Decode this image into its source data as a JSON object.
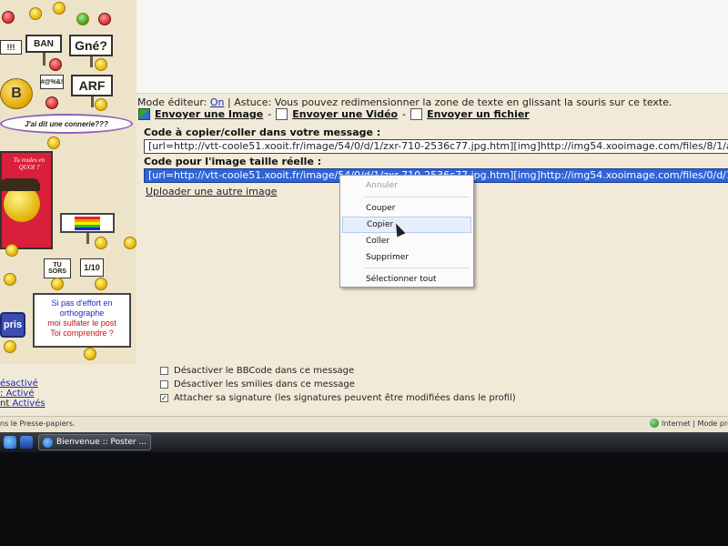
{
  "editor": {
    "mode_label": "Mode éditeur:",
    "mode_value": "On",
    "tip": " | Astuce: Vous pouvez redimensionner la zone de texte en glissant la souris sur ce texte.",
    "send_image": "Envoyer une Image",
    "send_video": "Envoyer une Vidéo",
    "send_file": "Envoyer un fichier",
    "sep": "-",
    "copy_label": "Code à copier/coller dans votre message :",
    "code_message": "[url=http://vtt-coole51.xooit.fr/image/54/0/d/1/zxr-710-2536c77.jpg.htm][img]http://img54.xooimage.com/files/8/1/a",
    "real_size_label": "Code pour l'image taille réelle :",
    "code_real": "[url=http://vtt-coole51.xooit.fr/image/54/0/d/1/zxr-710-2536c77.jpg.htm][img]http://img54.xooimage.com/files/0/d/1",
    "upload_other": "Uploader une autre image"
  },
  "context_menu": {
    "items": [
      "Annuler",
      "Couper",
      "Copier",
      "Coller",
      "Supprimer",
      "Sélectionner tout"
    ],
    "hovered": "Copier",
    "disabled": "Annuler"
  },
  "options": [
    {
      "label": "Désactiver le BBCode dans ce message",
      "checked": false
    },
    {
      "label": "Désactiver les smilies dans ce message",
      "checked": false
    },
    {
      "label": "Attacher sa signature (les signatures peuvent être modifiées dans le profil)",
      "checked": true
    }
  ],
  "left_links": {
    "l1": "ésactivé",
    "l2_pre": ": ",
    "l2": "Activé",
    "l3_pre": "nt ",
    "l3": "Activés"
  },
  "smilies": {
    "ban": "BAN",
    "gne": "Gné?",
    "excl": "!!!",
    "arf": "ARF",
    "speech": "#@%&!",
    "bubble": "J'ai dit une connerie???",
    "quoi": "Tu roules en QUOI ?",
    "b": "B",
    "tusors": "TU SORS",
    "score": "1/10",
    "pris": "pris",
    "ortho_1": "Si pas d'effort en orthographe",
    "ortho_2": "moi sulfater le post",
    "ortho_3": "Toi comprendre ?"
  },
  "statusbar": {
    "left": "ns le Presse-papiers.",
    "zone": "Internet | Mode prot"
  },
  "taskbar": {
    "window_title": "Bienvenue :: Poster ..."
  }
}
